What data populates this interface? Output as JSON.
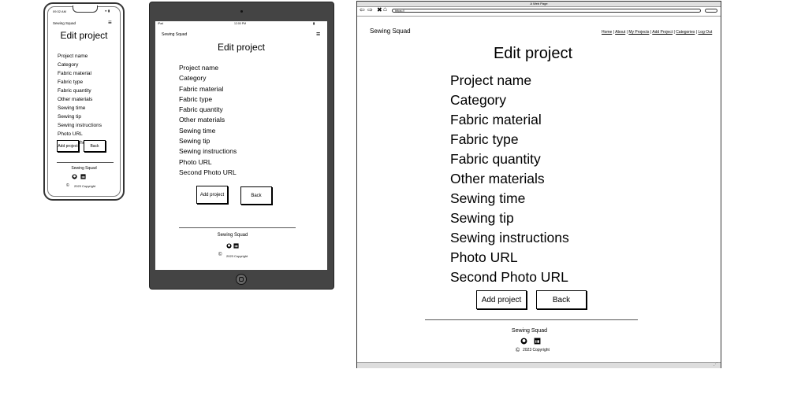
{
  "brand": "Sewing Squad",
  "page_title": "Edit project",
  "fields": [
    "Project name",
    "Category",
    "Fabric material",
    "Fabric type",
    "Fabric quantity",
    "Other materials",
    "Sewing time",
    "Sewing tip",
    "Sewing instructions",
    "Photo URL",
    "Second Photo URL"
  ],
  "buttons": {
    "add": "Add project",
    "back": "Back"
  },
  "footer": {
    "brand": "Sewing Squad",
    "copyright": "2023 Copyright"
  },
  "phone": {
    "status_time": "09:32 AM"
  },
  "tablet": {
    "status_left": "iPad",
    "status_center": "12:00 PM"
  },
  "browser": {
    "window_title": "A Web Page",
    "url": "https://"
  },
  "nav": [
    "Home",
    "About",
    "My Projects",
    "Add Project",
    "Categories",
    "Log Out"
  ],
  "icons": {
    "menu": "hamburger-icon",
    "github": "github-icon",
    "linkedin": "linkedin-icon",
    "copyright": "copyright-icon"
  }
}
